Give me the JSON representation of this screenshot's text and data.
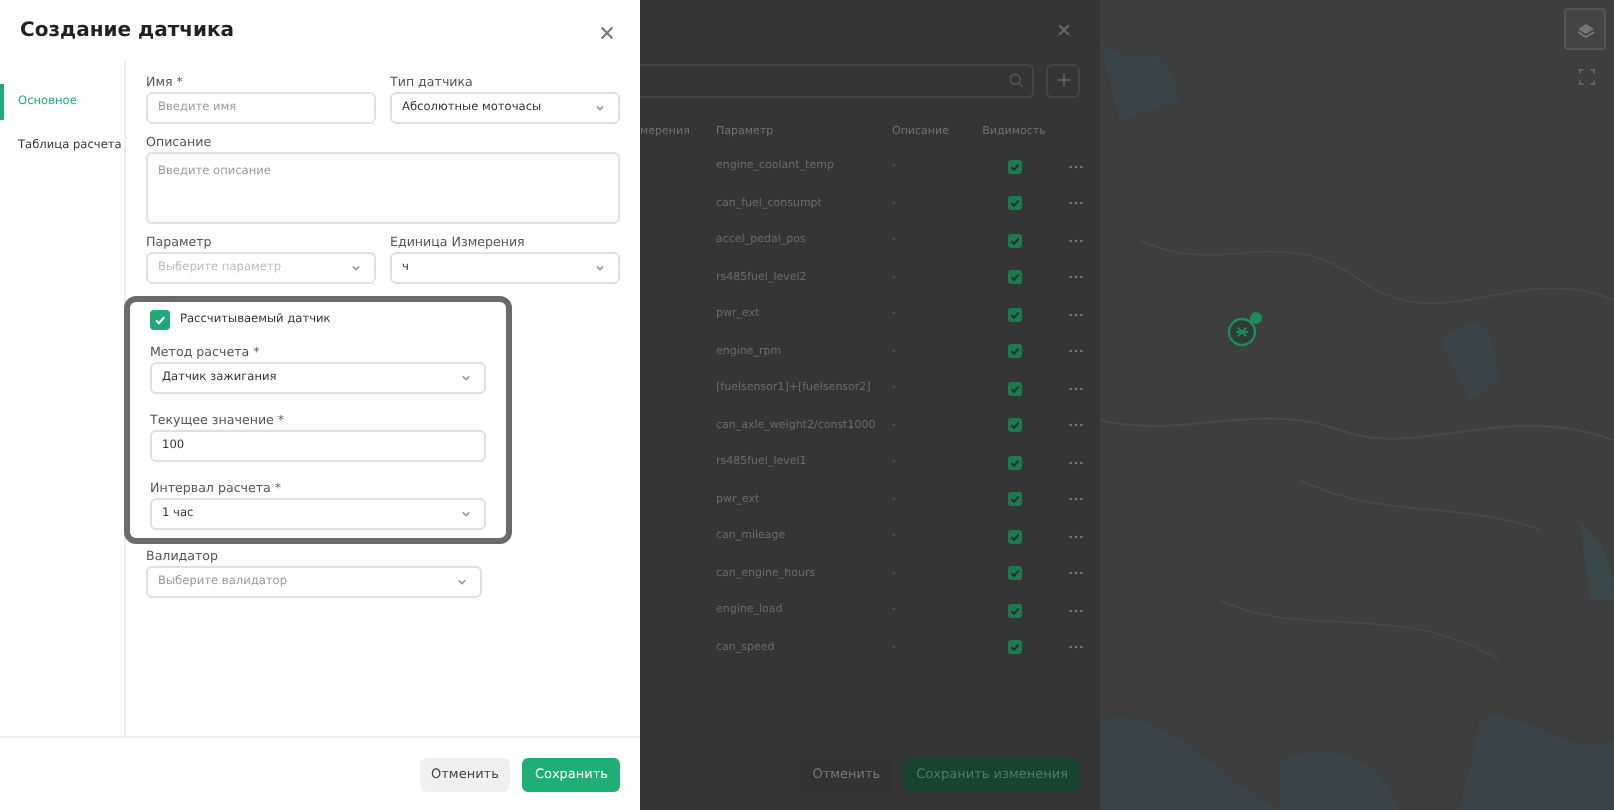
{
  "dialog": {
    "title": "Создание датчика",
    "nav": [
      {
        "label": "Основное",
        "selected": true
      },
      {
        "label": "Таблица расчета",
        "selected": false
      }
    ],
    "fields": [
      {
        "kind": "input",
        "label": "Имя *",
        "placeholder": "Введите имя"
      },
      {
        "kind": "select",
        "label": "Тип датчика",
        "value": "Абсолютные моточасы"
      },
      {
        "kind": "textarea",
        "label": "Описание",
        "placeholder": "Введите описание"
      },
      {
        "kind": "select",
        "label": "Параметр",
        "placeholder": "Выберите параметр",
        "disabled": true
      },
      {
        "kind": "select",
        "label": "Единица Измерения",
        "value": "ч"
      }
    ],
    "calculated": {
      "label": "Рассчитываемый датчик",
      "checked": true,
      "highlighted": true,
      "fields": [
        {
          "kind": "select",
          "label": "Метод расчета *",
          "value": "Датчик зажигания"
        },
        {
          "kind": "input",
          "label": "Текущее значение *",
          "value": "100"
        },
        {
          "kind": "select",
          "label": "Интервал расчета *",
          "value": "1 час"
        }
      ]
    },
    "validator": {
      "kind": "select",
      "label": "Валидатор",
      "placeholder": "Выберите валидатор"
    },
    "buttons": [
      {
        "label": "Отменить",
        "kind": "secondary"
      },
      {
        "label": "Сохранить",
        "kind": "primary"
      }
    ]
  },
  "background": {
    "columns": [
      "мерения",
      "Параметр",
      "Описание",
      "Видимость"
    ],
    "rows": [
      {
        "parameter": "engine_coolant_temp",
        "description": "-",
        "visible": true
      },
      {
        "parameter": "can_fuel_consumpt",
        "description": "-",
        "visible": true
      },
      {
        "parameter": "accel_pedal_pos",
        "description": "-",
        "visible": true
      },
      {
        "parameter": "rs485fuel_level2",
        "description": "-",
        "visible": true
      },
      {
        "parameter": "pwr_ext",
        "description": "-",
        "visible": true
      },
      {
        "parameter": "engine_rpm",
        "description": "-",
        "visible": true
      },
      {
        "parameter": "[fuelsensor1]+[fuelsensor2]",
        "description": "-",
        "visible": true
      },
      {
        "parameter": "can_axle_weight2/const1000",
        "description": "-",
        "visible": true
      },
      {
        "parameter": "rs485fuel_level1",
        "description": "-",
        "visible": true
      },
      {
        "parameter": "pwr_ext",
        "description": "-",
        "visible": true
      },
      {
        "parameter": "can_mileage",
        "description": "-",
        "visible": true
      },
      {
        "parameter": "can_engine_hours",
        "description": "-",
        "visible": true
      },
      {
        "parameter": "engine_load",
        "description": "-",
        "visible": true
      },
      {
        "parameter": "can_speed",
        "description": "-",
        "visible": true
      }
    ],
    "buttons": [
      {
        "label": "Отменить",
        "kind": "secondary"
      },
      {
        "label": "Сохранить изменения",
        "kind": "primary"
      }
    ]
  }
}
